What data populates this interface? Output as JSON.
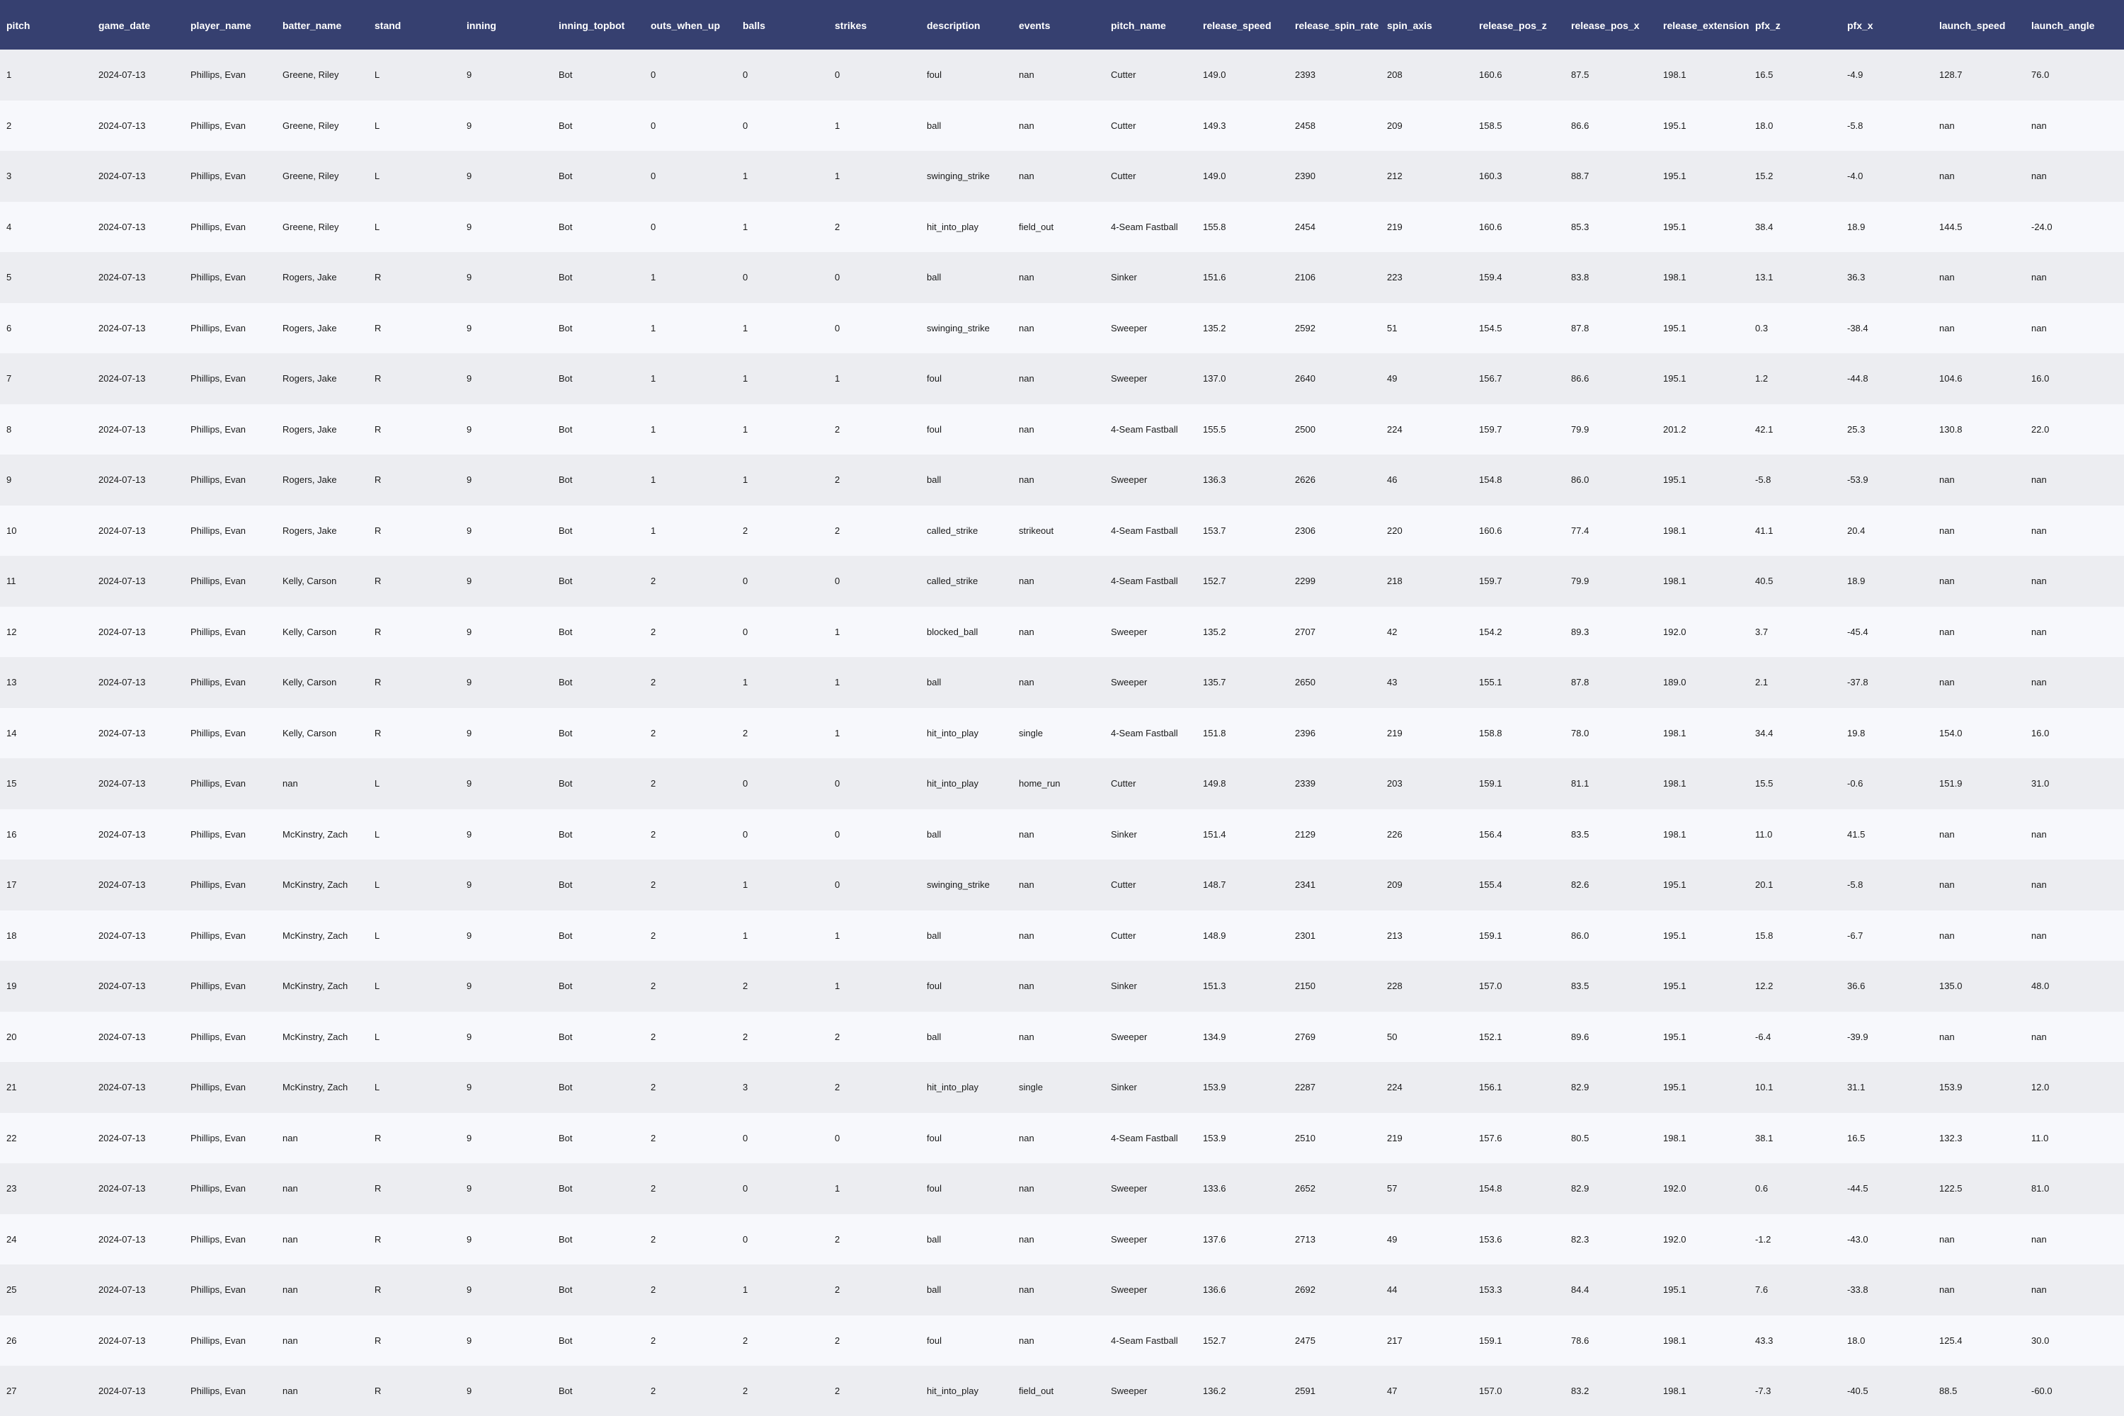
{
  "table": {
    "columns": [
      "pitch",
      "game_date",
      "player_name",
      "batter_name",
      "stand",
      "inning",
      "inning_topbot",
      "outs_when_up",
      "balls",
      "strikes",
      "description",
      "events",
      "pitch_name",
      "release_speed",
      "release_spin_rate",
      "spin_axis",
      "release_pos_z",
      "release_pos_x",
      "release_extension",
      "pfx_z",
      "pfx_x",
      "launch_speed",
      "launch_angle"
    ],
    "rows": [
      [
        "1",
        "2024-07-13",
        "Phillips, Evan",
        "Greene, Riley",
        "L",
        "9",
        "Bot",
        "0",
        "0",
        "0",
        "foul",
        "nan",
        "Cutter",
        "149.0",
        "2393",
        "208",
        "160.6",
        "87.5",
        "198.1",
        "16.5",
        "-4.9",
        "128.7",
        "76.0"
      ],
      [
        "2",
        "2024-07-13",
        "Phillips, Evan",
        "Greene, Riley",
        "L",
        "9",
        "Bot",
        "0",
        "0",
        "1",
        "ball",
        "nan",
        "Cutter",
        "149.3",
        "2458",
        "209",
        "158.5",
        "86.6",
        "195.1",
        "18.0",
        "-5.8",
        "nan",
        "nan"
      ],
      [
        "3",
        "2024-07-13",
        "Phillips, Evan",
        "Greene, Riley",
        "L",
        "9",
        "Bot",
        "0",
        "1",
        "1",
        "swinging_strike",
        "nan",
        "Cutter",
        "149.0",
        "2390",
        "212",
        "160.3",
        "88.7",
        "195.1",
        "15.2",
        "-4.0",
        "nan",
        "nan"
      ],
      [
        "4",
        "2024-07-13",
        "Phillips, Evan",
        "Greene, Riley",
        "L",
        "9",
        "Bot",
        "0",
        "1",
        "2",
        "hit_into_play",
        "field_out",
        "4-Seam Fastball",
        "155.8",
        "2454",
        "219",
        "160.6",
        "85.3",
        "195.1",
        "38.4",
        "18.9",
        "144.5",
        "-24.0"
      ],
      [
        "5",
        "2024-07-13",
        "Phillips, Evan",
        "Rogers, Jake",
        "R",
        "9",
        "Bot",
        "1",
        "0",
        "0",
        "ball",
        "nan",
        "Sinker",
        "151.6",
        "2106",
        "223",
        "159.4",
        "83.8",
        "198.1",
        "13.1",
        "36.3",
        "nan",
        "nan"
      ],
      [
        "6",
        "2024-07-13",
        "Phillips, Evan",
        "Rogers, Jake",
        "R",
        "9",
        "Bot",
        "1",
        "1",
        "0",
        "swinging_strike",
        "nan",
        "Sweeper",
        "135.2",
        "2592",
        "51",
        "154.5",
        "87.8",
        "195.1",
        "0.3",
        "-38.4",
        "nan",
        "nan"
      ],
      [
        "7",
        "2024-07-13",
        "Phillips, Evan",
        "Rogers, Jake",
        "R",
        "9",
        "Bot",
        "1",
        "1",
        "1",
        "foul",
        "nan",
        "Sweeper",
        "137.0",
        "2640",
        "49",
        "156.7",
        "86.6",
        "195.1",
        "1.2",
        "-44.8",
        "104.6",
        "16.0"
      ],
      [
        "8",
        "2024-07-13",
        "Phillips, Evan",
        "Rogers, Jake",
        "R",
        "9",
        "Bot",
        "1",
        "1",
        "2",
        "foul",
        "nan",
        "4-Seam Fastball",
        "155.5",
        "2500",
        "224",
        "159.7",
        "79.9",
        "201.2",
        "42.1",
        "25.3",
        "130.8",
        "22.0"
      ],
      [
        "9",
        "2024-07-13",
        "Phillips, Evan",
        "Rogers, Jake",
        "R",
        "9",
        "Bot",
        "1",
        "1",
        "2",
        "ball",
        "nan",
        "Sweeper",
        "136.3",
        "2626",
        "46",
        "154.8",
        "86.0",
        "195.1",
        "-5.8",
        "-53.9",
        "nan",
        "nan"
      ],
      [
        "10",
        "2024-07-13",
        "Phillips, Evan",
        "Rogers, Jake",
        "R",
        "9",
        "Bot",
        "1",
        "2",
        "2",
        "called_strike",
        "strikeout",
        "4-Seam Fastball",
        "153.7",
        "2306",
        "220",
        "160.6",
        "77.4",
        "198.1",
        "41.1",
        "20.4",
        "nan",
        "nan"
      ],
      [
        "11",
        "2024-07-13",
        "Phillips, Evan",
        "Kelly, Carson",
        "R",
        "9",
        "Bot",
        "2",
        "0",
        "0",
        "called_strike",
        "nan",
        "4-Seam Fastball",
        "152.7",
        "2299",
        "218",
        "159.7",
        "79.9",
        "198.1",
        "40.5",
        "18.9",
        "nan",
        "nan"
      ],
      [
        "12",
        "2024-07-13",
        "Phillips, Evan",
        "Kelly, Carson",
        "R",
        "9",
        "Bot",
        "2",
        "0",
        "1",
        "blocked_ball",
        "nan",
        "Sweeper",
        "135.2",
        "2707",
        "42",
        "154.2",
        "89.3",
        "192.0",
        "3.7",
        "-45.4",
        "nan",
        "nan"
      ],
      [
        "13",
        "2024-07-13",
        "Phillips, Evan",
        "Kelly, Carson",
        "R",
        "9",
        "Bot",
        "2",
        "1",
        "1",
        "ball",
        "nan",
        "Sweeper",
        "135.7",
        "2650",
        "43",
        "155.1",
        "87.8",
        "189.0",
        "2.1",
        "-37.8",
        "nan",
        "nan"
      ],
      [
        "14",
        "2024-07-13",
        "Phillips, Evan",
        "Kelly, Carson",
        "R",
        "9",
        "Bot",
        "2",
        "2",
        "1",
        "hit_into_play",
        "single",
        "4-Seam Fastball",
        "151.8",
        "2396",
        "219",
        "158.8",
        "78.0",
        "198.1",
        "34.4",
        "19.8",
        "154.0",
        "16.0"
      ],
      [
        "15",
        "2024-07-13",
        "Phillips, Evan",
        "nan",
        "L",
        "9",
        "Bot",
        "2",
        "0",
        "0",
        "hit_into_play",
        "home_run",
        "Cutter",
        "149.8",
        "2339",
        "203",
        "159.1",
        "81.1",
        "198.1",
        "15.5",
        "-0.6",
        "151.9",
        "31.0"
      ],
      [
        "16",
        "2024-07-13",
        "Phillips, Evan",
        "McKinstry, Zach",
        "L",
        "9",
        "Bot",
        "2",
        "0",
        "0",
        "ball",
        "nan",
        "Sinker",
        "151.4",
        "2129",
        "226",
        "156.4",
        "83.5",
        "198.1",
        "11.0",
        "41.5",
        "nan",
        "nan"
      ],
      [
        "17",
        "2024-07-13",
        "Phillips, Evan",
        "McKinstry, Zach",
        "L",
        "9",
        "Bot",
        "2",
        "1",
        "0",
        "swinging_strike",
        "nan",
        "Cutter",
        "148.7",
        "2341",
        "209",
        "155.4",
        "82.6",
        "195.1",
        "20.1",
        "-5.8",
        "nan",
        "nan"
      ],
      [
        "18",
        "2024-07-13",
        "Phillips, Evan",
        "McKinstry, Zach",
        "L",
        "9",
        "Bot",
        "2",
        "1",
        "1",
        "ball",
        "nan",
        "Cutter",
        "148.9",
        "2301",
        "213",
        "159.1",
        "86.0",
        "195.1",
        "15.8",
        "-6.7",
        "nan",
        "nan"
      ],
      [
        "19",
        "2024-07-13",
        "Phillips, Evan",
        "McKinstry, Zach",
        "L",
        "9",
        "Bot",
        "2",
        "2",
        "1",
        "foul",
        "nan",
        "Sinker",
        "151.3",
        "2150",
        "228",
        "157.0",
        "83.5",
        "195.1",
        "12.2",
        "36.6",
        "135.0",
        "48.0"
      ],
      [
        "20",
        "2024-07-13",
        "Phillips, Evan",
        "McKinstry, Zach",
        "L",
        "9",
        "Bot",
        "2",
        "2",
        "2",
        "ball",
        "nan",
        "Sweeper",
        "134.9",
        "2769",
        "50",
        "152.1",
        "89.6",
        "195.1",
        "-6.4",
        "-39.9",
        "nan",
        "nan"
      ],
      [
        "21",
        "2024-07-13",
        "Phillips, Evan",
        "McKinstry, Zach",
        "L",
        "9",
        "Bot",
        "2",
        "3",
        "2",
        "hit_into_play",
        "single",
        "Sinker",
        "153.9",
        "2287",
        "224",
        "156.1",
        "82.9",
        "195.1",
        "10.1",
        "31.1",
        "153.9",
        "12.0"
      ],
      [
        "22",
        "2024-07-13",
        "Phillips, Evan",
        "nan",
        "R",
        "9",
        "Bot",
        "2",
        "0",
        "0",
        "foul",
        "nan",
        "4-Seam Fastball",
        "153.9",
        "2510",
        "219",
        "157.6",
        "80.5",
        "198.1",
        "38.1",
        "16.5",
        "132.3",
        "11.0"
      ],
      [
        "23",
        "2024-07-13",
        "Phillips, Evan",
        "nan",
        "R",
        "9",
        "Bot",
        "2",
        "0",
        "1",
        "foul",
        "nan",
        "Sweeper",
        "133.6",
        "2652",
        "57",
        "154.8",
        "82.9",
        "192.0",
        "0.6",
        "-44.5",
        "122.5",
        "81.0"
      ],
      [
        "24",
        "2024-07-13",
        "Phillips, Evan",
        "nan",
        "R",
        "9",
        "Bot",
        "2",
        "0",
        "2",
        "ball",
        "nan",
        "Sweeper",
        "137.6",
        "2713",
        "49",
        "153.6",
        "82.3",
        "192.0",
        "-1.2",
        "-43.0",
        "nan",
        "nan"
      ],
      [
        "25",
        "2024-07-13",
        "Phillips, Evan",
        "nan",
        "R",
        "9",
        "Bot",
        "2",
        "1",
        "2",
        "ball",
        "nan",
        "Sweeper",
        "136.6",
        "2692",
        "44",
        "153.3",
        "84.4",
        "195.1",
        "7.6",
        "-33.8",
        "nan",
        "nan"
      ],
      [
        "26",
        "2024-07-13",
        "Phillips, Evan",
        "nan",
        "R",
        "9",
        "Bot",
        "2",
        "2",
        "2",
        "foul",
        "nan",
        "4-Seam Fastball",
        "152.7",
        "2475",
        "217",
        "159.1",
        "78.6",
        "198.1",
        "43.3",
        "18.0",
        "125.4",
        "30.0"
      ],
      [
        "27",
        "2024-07-13",
        "Phillips, Evan",
        "nan",
        "R",
        "9",
        "Bot",
        "2",
        "2",
        "2",
        "hit_into_play",
        "field_out",
        "Sweeper",
        "136.2",
        "2591",
        "47",
        "157.0",
        "83.2",
        "198.1",
        "-7.3",
        "-40.5",
        "88.5",
        "-60.0"
      ]
    ]
  }
}
